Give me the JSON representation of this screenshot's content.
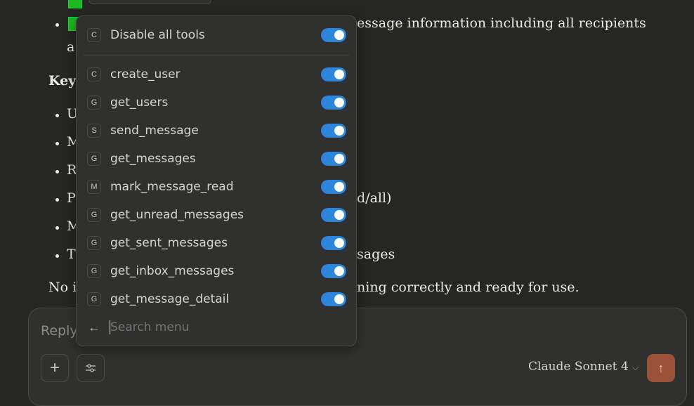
{
  "conversation": {
    "line1_fragment": "essage information including all recipients",
    "line2_fragment": "a",
    "heading_fragment": "Key",
    "bullets": [
      {
        "left": "U",
        "right": ""
      },
      {
        "left": "M",
        "right": ""
      },
      {
        "left": "R",
        "right": ""
      },
      {
        "left": "P",
        "right": "d/all)"
      },
      {
        "left": "M",
        "right": ""
      },
      {
        "left": "T",
        "right": "sages"
      }
    ],
    "closing_left": "No is",
    "closing_right": "ning correctly and ready for use."
  },
  "tools_menu": {
    "disable_all": {
      "badge": "C",
      "label": "Disable all tools",
      "enabled": true
    },
    "tools": [
      {
        "badge": "C",
        "label": "create_user",
        "enabled": true
      },
      {
        "badge": "G",
        "label": "get_users",
        "enabled": true
      },
      {
        "badge": "S",
        "label": "send_message",
        "enabled": true
      },
      {
        "badge": "G",
        "label": "get_messages",
        "enabled": true
      },
      {
        "badge": "M",
        "label": "mark_message_read",
        "enabled": true
      },
      {
        "badge": "G",
        "label": "get_unread_messages",
        "enabled": true
      },
      {
        "badge": "G",
        "label": "get_sent_messages",
        "enabled": true
      },
      {
        "badge": "G",
        "label": "get_inbox_messages",
        "enabled": true
      },
      {
        "badge": "G",
        "label": "get_message_detail",
        "enabled": true
      }
    ],
    "search_placeholder": "Search menu",
    "back_icon": "arrow-left-icon"
  },
  "composer": {
    "placeholder": "Reply",
    "add_icon": "plus-icon",
    "tools_icon": "sliders-icon",
    "model": "Claude Sonnet 4",
    "send_icon": "arrow-up-icon",
    "send_color": "#9a5138",
    "toggle_color": "#2c84db"
  }
}
